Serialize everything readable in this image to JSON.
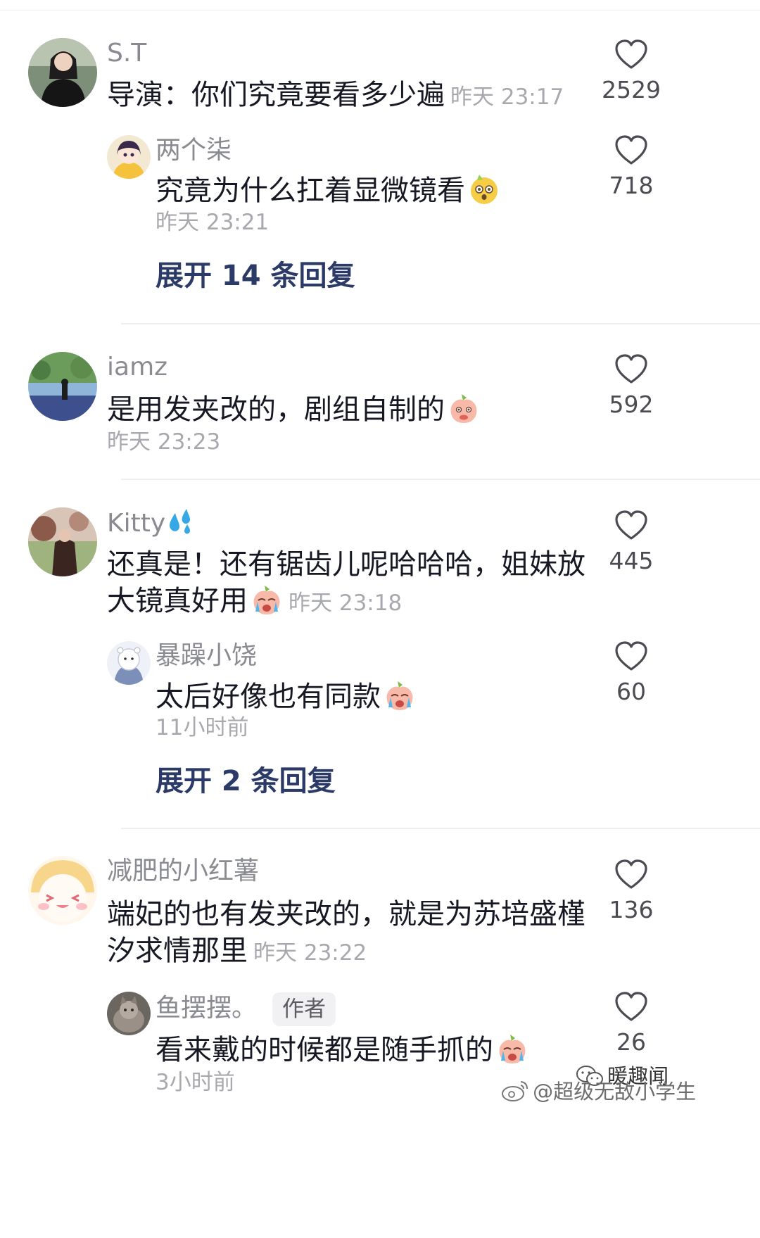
{
  "comments": [
    {
      "username": "S.T",
      "text": "导演：你们究竟要看多少遍",
      "time": "昨天 23:17",
      "likes": "2529",
      "replies": [
        {
          "username": "两个柒",
          "text": "究竟为什么扛着显微镜看",
          "emoji": "emoji-shocked-dog",
          "time": "昨天 23:21",
          "likes": "718"
        }
      ],
      "expand_label": "展开 14 条回复"
    },
    {
      "username": "iamz",
      "text": "是用发夹改的，剧组自制的",
      "emoji": "emoji-peach-shy",
      "time": "昨天 23:23",
      "likes": "592"
    },
    {
      "username": "Kitty",
      "username_icon": "sweat-drops-icon",
      "text_line1": "还真是！还有锯齿儿呢哈哈哈，姐妹放",
      "text_line2": "大镜真好用",
      "emoji": "emoji-peach-crying",
      "time": "昨天 23:18",
      "likes": "445",
      "replies": [
        {
          "username": "暴躁小饶",
          "text": "太后好像也有同款",
          "emoji": "emoji-peach-crying",
          "time": "11小时前",
          "likes": "60"
        }
      ],
      "expand_label": "展开 2 条回复"
    },
    {
      "username": "减肥的小红薯",
      "text_line1": "端妃的也有发夹改的，就是为苏培盛槿",
      "text_line2": "汐求情那里",
      "time": "昨天 23:22",
      "likes": "136",
      "replies": [
        {
          "username": "鱼摆摆。",
          "badge": "作者",
          "text": "看来戴的时候都是随手抓的",
          "emoji": "emoji-peach-crying",
          "time": "3小时前",
          "likes": "26"
        }
      ]
    }
  ],
  "watermark": {
    "wechat_text": "暖趣闻",
    "weibo_text": "@超级无敌小学生"
  },
  "colors": {
    "username": "#8a8b91",
    "text": "#161823",
    "timestamp": "#a8a9ae",
    "expand": "#2b3a67",
    "heart_stroke": "#4b4c52"
  }
}
